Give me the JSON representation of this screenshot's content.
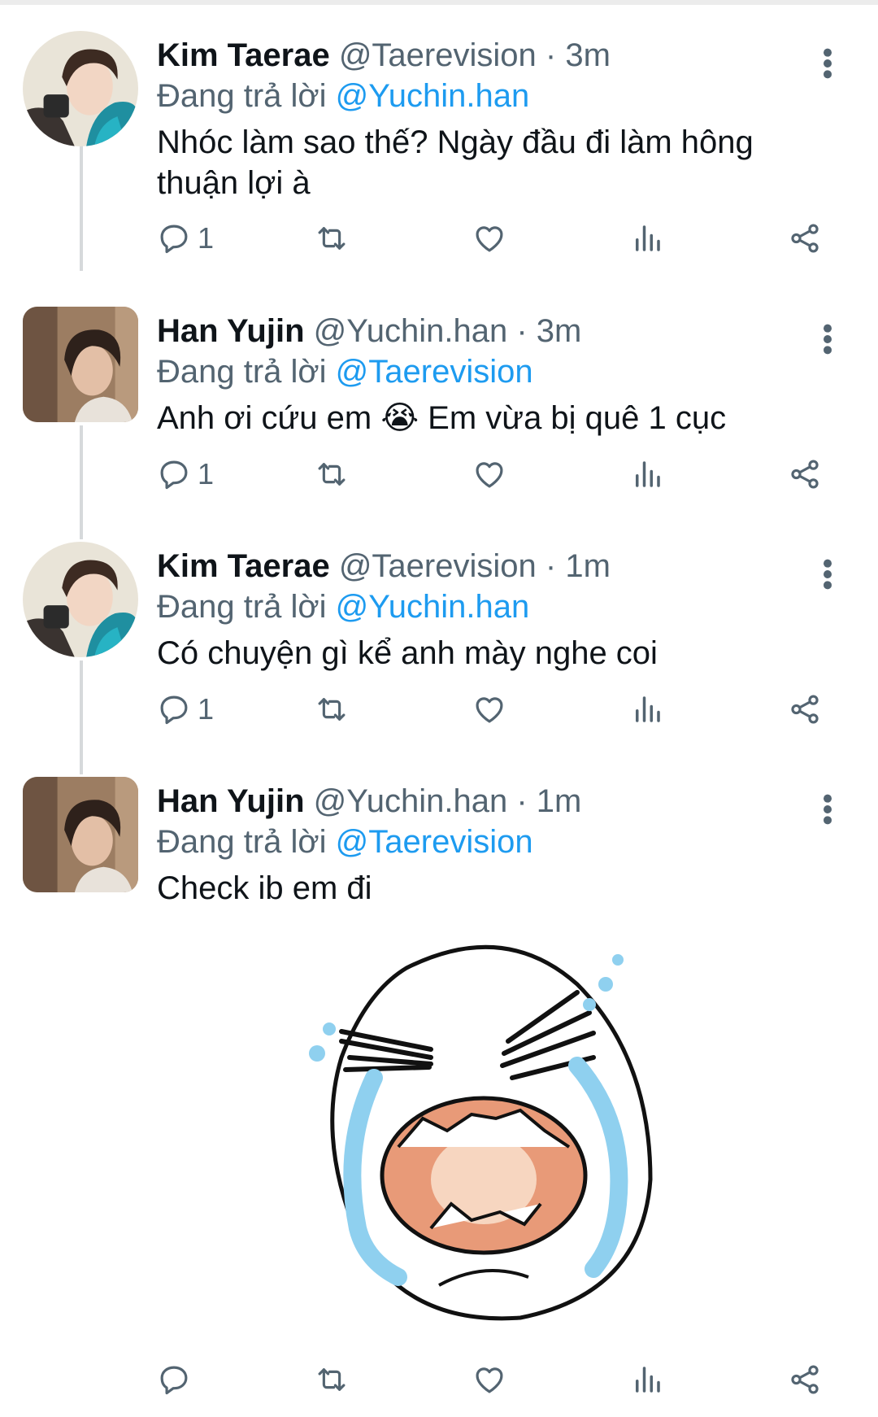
{
  "colors": {
    "accent": "#1d9bf0",
    "muted": "#536471",
    "thread": "#d6d9db"
  },
  "tweets": [
    {
      "name": "Kim Taerae",
      "handle": "@Taerevision",
      "time": "3m",
      "reply_prefix": "Đang trả lời",
      "reply_to": "@Yuchin.han",
      "text": "Nhóc làm sao thế? Ngày đầu đi làm hông thuận lợi à",
      "replies": "1"
    },
    {
      "name": "Han Yujin",
      "handle": "@Yuchin.han",
      "time": "3m",
      "reply_prefix": "Đang trả lời",
      "reply_to": "@Taerevision",
      "text": "Anh ơi cứu em 😭 Em vừa bị quê 1 cục",
      "replies": "1"
    },
    {
      "name": "Kim Taerae",
      "handle": "@Taerevision",
      "time": "1m",
      "reply_prefix": "Đang trả lời",
      "reply_to": "@Yuchin.han",
      "text": "Có chuyện gì kể anh mày nghe coi",
      "replies": "1"
    },
    {
      "name": "Han Yujin",
      "handle": "@Yuchin.han",
      "time": "1m",
      "reply_prefix": "Đang trả lời",
      "reply_to": "@Taerevision",
      "text": "Check ib em đi",
      "replies": ""
    }
  ],
  "separator": "·",
  "icons": [
    "reply-icon",
    "retweet-icon",
    "like-icon",
    "analytics-icon",
    "share-icon",
    "more-options-icon"
  ]
}
